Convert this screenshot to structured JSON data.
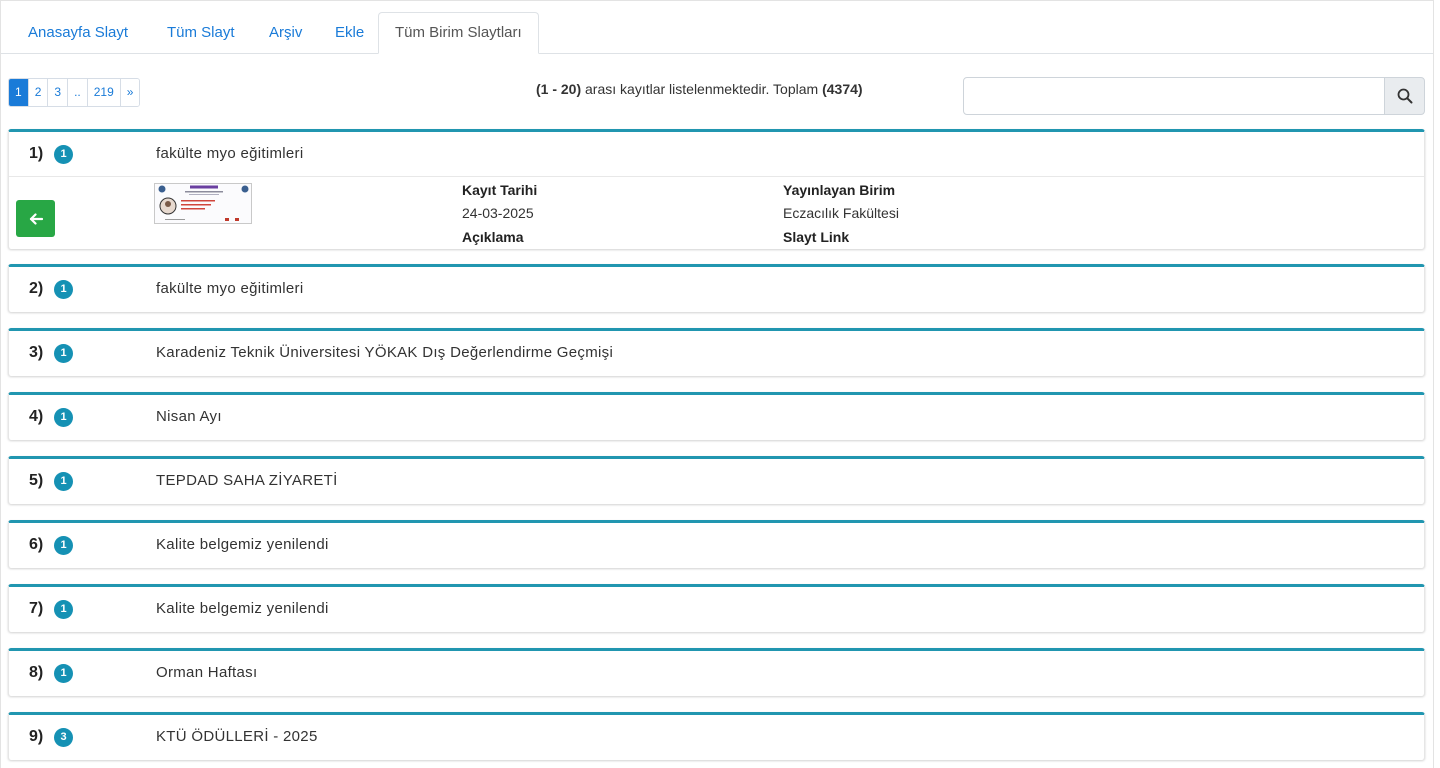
{
  "tabs": [
    {
      "label": "Anasayfa Slayt"
    },
    {
      "label": "Tüm Slayt"
    },
    {
      "label": "Arşiv"
    },
    {
      "label": "Ekle"
    },
    {
      "label": "Tüm Birim Slaytları"
    }
  ],
  "pagination": {
    "pages": [
      "1",
      "2",
      "3",
      "..",
      "219",
      "»"
    ],
    "current": "1"
  },
  "summary": {
    "range": "(1 - 20)",
    "text": " arası kayıtlar listelenmektedir. Toplam ",
    "total": "(4374)"
  },
  "search": {
    "value": "",
    "placeholder": "",
    "icon": "search-icon"
  },
  "detail": {
    "back_icon": "arrow-left-icon",
    "date_label": "Kayıt Tarihi",
    "date_value": "24-03-2025",
    "desc_label": "Açıklama",
    "unit_label": "Yayınlayan Birim",
    "unit_value": "Eczacılık Fakültesi",
    "link_label": "Slayt Link"
  },
  "records": [
    {
      "num": "1)",
      "badge": "1",
      "title": "fakülte myo eğitimleri"
    },
    {
      "num": "2)",
      "badge": "1",
      "title": "fakülte myo eğitimleri"
    },
    {
      "num": "3)",
      "badge": "1",
      "title": "Karadeniz Teknik Üniversitesi YÖKAK Dış Değerlendirme Geçmişi"
    },
    {
      "num": "4)",
      "badge": "1",
      "title": "Nisan Ayı"
    },
    {
      "num": "5)",
      "badge": "1",
      "title": "TEPDAD SAHA ZİYARETİ"
    },
    {
      "num": "6)",
      "badge": "1",
      "title": "Kalite belgemiz yenilendi"
    },
    {
      "num": "7)",
      "badge": "1",
      "title": "Kalite belgemiz yenilendi"
    },
    {
      "num": "8)",
      "badge": "1",
      "title": "Orman Haftası"
    },
    {
      "num": "9)",
      "badge": "3",
      "title": "KTÜ ÖDÜLLERİ - 2025"
    }
  ],
  "colors": {
    "accent": "#1a7bd8",
    "card_border": "#2196b0",
    "badge": "#1591b4",
    "back_button": "#28a745"
  }
}
